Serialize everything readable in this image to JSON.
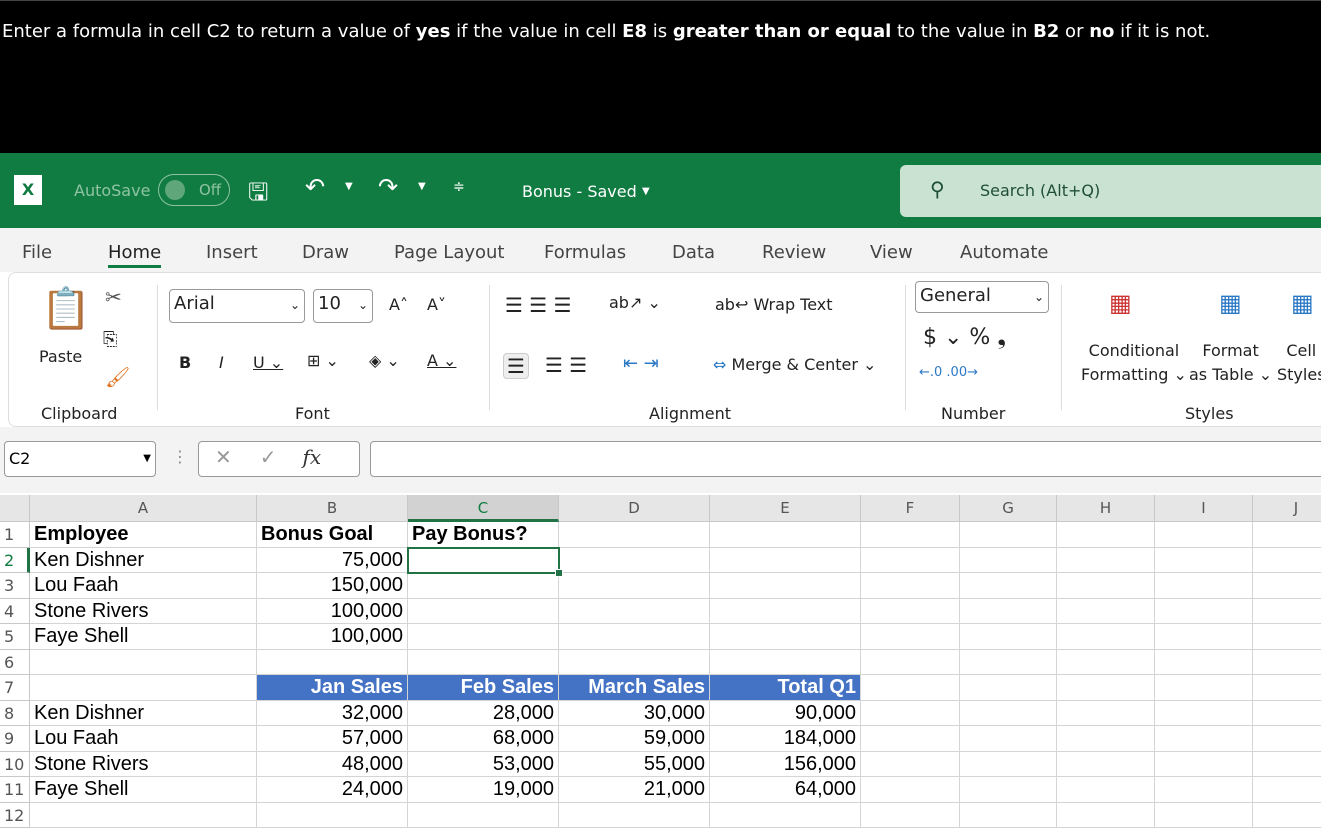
{
  "prompt": {
    "pre1": "Enter a formula in cell C2 to return a value of ",
    "b1": "yes",
    "pre2": " if the value in cell ",
    "b2": "E8",
    "pre3": " is ",
    "b3": "greater than or equal",
    "pre4": " to the value in ",
    "b4": "B2",
    "pre5": " or ",
    "b5": "no",
    "pre6": " if it is not."
  },
  "titlebar": {
    "autosave": "AutoSave",
    "toggle": "Off",
    "doc_title": "Bonus - Saved",
    "search_placeholder": "Search (Alt+Q)"
  },
  "tabs": [
    "File",
    "Home",
    "Insert",
    "Draw",
    "Page Layout",
    "Formulas",
    "Data",
    "Review",
    "View",
    "Automate"
  ],
  "ribbon": {
    "paste": "Paste",
    "clipboard": "Clipboard",
    "font_name": "Arial",
    "font_size": "10",
    "font": "Font",
    "wrap_text": "Wrap Text",
    "merge_center": "Merge & Center",
    "alignment": "Alignment",
    "number_format": "General",
    "number": "Number",
    "cond_fmt_1": "Conditional",
    "cond_fmt_2": "Formatting",
    "fmt_table_1": "Format",
    "fmt_table_2": "as Table",
    "cell_styles_1": "Cell",
    "cell_styles_2": "Styles",
    "styles": "Styles"
  },
  "formula_bar": {
    "name_box": "C2",
    "fx": "fx",
    "value": ""
  },
  "colors": {
    "excel_green": "#107c41",
    "header_blue": "#4472c4"
  },
  "sheet": {
    "columns": [
      "A",
      "B",
      "C",
      "D",
      "E",
      "F",
      "G",
      "H",
      "I",
      "J"
    ],
    "rows": [
      [
        "Employee",
        "Bonus Goal",
        "Pay Bonus?",
        "",
        "",
        "",
        "",
        "",
        "",
        ""
      ],
      [
        "Ken Dishner",
        "75,000",
        "",
        "",
        "",
        "",
        "",
        "",
        "",
        ""
      ],
      [
        "Lou Faah",
        "150,000",
        "",
        "",
        "",
        "",
        "",
        "",
        "",
        ""
      ],
      [
        "Stone Rivers",
        "100,000",
        "",
        "",
        "",
        "",
        "",
        "",
        "",
        ""
      ],
      [
        "Faye Shell",
        "100,000",
        "",
        "",
        "",
        "",
        "",
        "",
        "",
        ""
      ],
      [
        "",
        "",
        "",
        "",
        "",
        "",
        "",
        "",
        "",
        ""
      ],
      [
        "",
        "Jan Sales",
        "Feb Sales",
        "March Sales",
        "Total Q1",
        "",
        "",
        "",
        "",
        ""
      ],
      [
        "Ken Dishner",
        "32,000",
        "28,000",
        "30,000",
        "90,000",
        "",
        "",
        "",
        "",
        ""
      ],
      [
        "Lou Faah",
        "57,000",
        "68,000",
        "59,000",
        "184,000",
        "",
        "",
        "",
        "",
        ""
      ],
      [
        "Stone Rivers",
        "48,000",
        "53,000",
        "55,000",
        "156,000",
        "",
        "",
        "",
        "",
        ""
      ],
      [
        "Faye Shell",
        "24,000",
        "19,000",
        "21,000",
        "64,000",
        "",
        "",
        "",
        "",
        ""
      ]
    ],
    "active_cell": "C2"
  }
}
